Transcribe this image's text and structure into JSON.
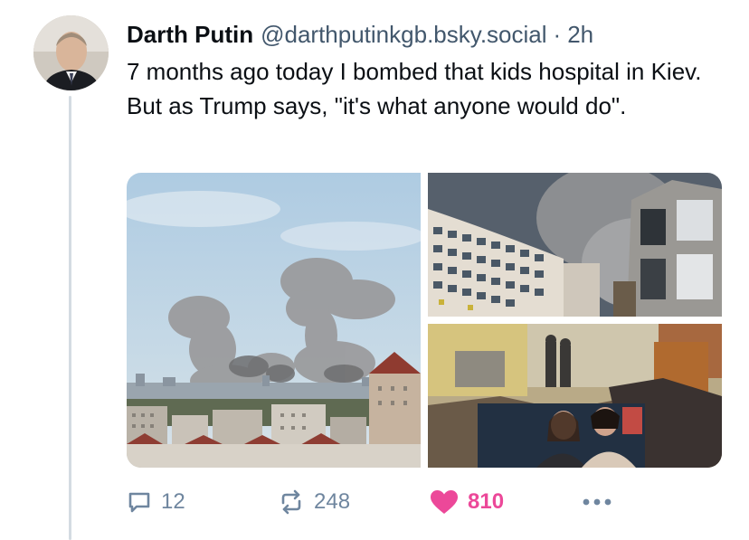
{
  "post": {
    "author": {
      "display_name": "Darth Putin",
      "handle": "@darthputinkgb.bsky.social",
      "separator": "·",
      "time": "2h"
    },
    "text": "7 months ago today I bombed that kids hospital in Kiev. But as Trump says, \"it's what anyone would do\".",
    "images": [
      {
        "icon": "city-smoke-photo"
      },
      {
        "icon": "damaged-building-photo"
      },
      {
        "icon": "rubble-photo"
      }
    ],
    "actions": {
      "reply_count": "12",
      "repost_count": "248",
      "like_count": "810"
    }
  },
  "colors": {
    "text": "#0b0f14",
    "secondary": "#42576c",
    "muted": "#6f869f",
    "like": "#ec4899",
    "thread_line": "#d4dbe2"
  }
}
